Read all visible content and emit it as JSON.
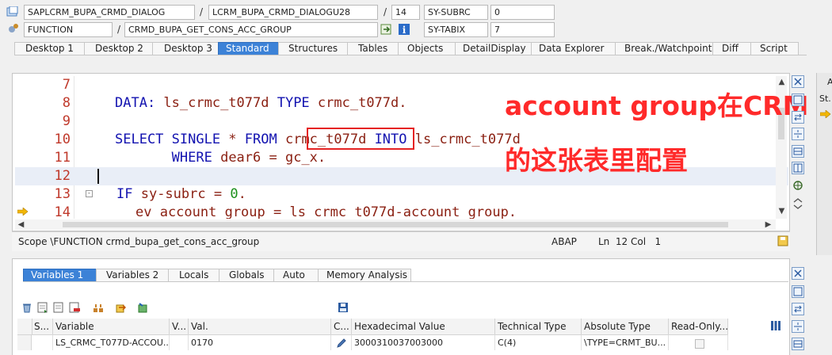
{
  "header": {
    "program": "SAPLCRM_BUPA_CRMD_DIALOG",
    "include": "LCRM_BUPA_CRMD_DIALOGU28",
    "line": "14",
    "var1_name": "SY-SUBRC",
    "var1_value": "0",
    "event_type": "FUNCTION",
    "event_name": "CRMD_BUPA_GET_CONS_ACC_GROUP",
    "var2_name": "SY-TABIX",
    "var2_value": "7",
    "slash": "/"
  },
  "tabs": [
    {
      "label": "Desktop 1"
    },
    {
      "label": "Desktop 2"
    },
    {
      "label": "Desktop 3"
    },
    {
      "label": "Standard"
    },
    {
      "label": "Structures"
    },
    {
      "label": "Tables"
    },
    {
      "label": "Objects"
    },
    {
      "label": "DetailDisplay"
    },
    {
      "label": "Data Explorer"
    },
    {
      "label": "Break./Watchpoints"
    },
    {
      "label": "Diff"
    },
    {
      "label": "Script"
    }
  ],
  "code": {
    "lines": [
      {
        "num": "7",
        "text": ""
      },
      {
        "num": "8",
        "text": "DATA: ls_crmc_t077d TYPE crmc_t077d."
      },
      {
        "num": "9",
        "text": ""
      },
      {
        "num": "10",
        "text": "SELECT SINGLE * FROM crmc_t077d INTO ls_crmc_t077d"
      },
      {
        "num": "11",
        "text": "       WHERE dear6 = gc_x."
      },
      {
        "num": "12",
        "text": ""
      },
      {
        "num": "13",
        "text": "IF sy-subrc = 0."
      },
      {
        "num": "14",
        "text": "  ev_account_group = ls_crmc_t077d-account_group."
      }
    ]
  },
  "annotation": {
    "line1": "account group在CRM",
    "line2": "的这张表里配置"
  },
  "statusbar": {
    "scope": "Scope \\FUNCTION crmd_bupa_get_cons_acc_group",
    "language": "ABAP",
    "position": "Ln  12 Col   1"
  },
  "var_tabs": [
    {
      "label": "Variables 1"
    },
    {
      "label": "Variables 2"
    },
    {
      "label": "Locals"
    },
    {
      "label": "Globals"
    },
    {
      "label": "Auto"
    },
    {
      "label": "Memory Analysis"
    }
  ],
  "grid": {
    "headers": [
      "S...",
      "Variable",
      "V...",
      "Val.",
      "C...",
      "Hexadecimal Value",
      "Technical Type",
      "Absolute Type",
      "Read-Only..."
    ],
    "row": {
      "variable": "LS_CRMC_T077D-ACCOU...",
      "value": "0170",
      "hex": "3000310037003000",
      "tech_type": "C(4)",
      "abs_type": "\\TYPE=CRMT_BU..."
    }
  },
  "side": {
    "label_a": "A",
    "label_st": "St."
  },
  "colors": {
    "accent": "#3c82d7",
    "annotation": "#ff2a2a",
    "keyword": "#1212b0",
    "identifier": "#8a1f11"
  }
}
